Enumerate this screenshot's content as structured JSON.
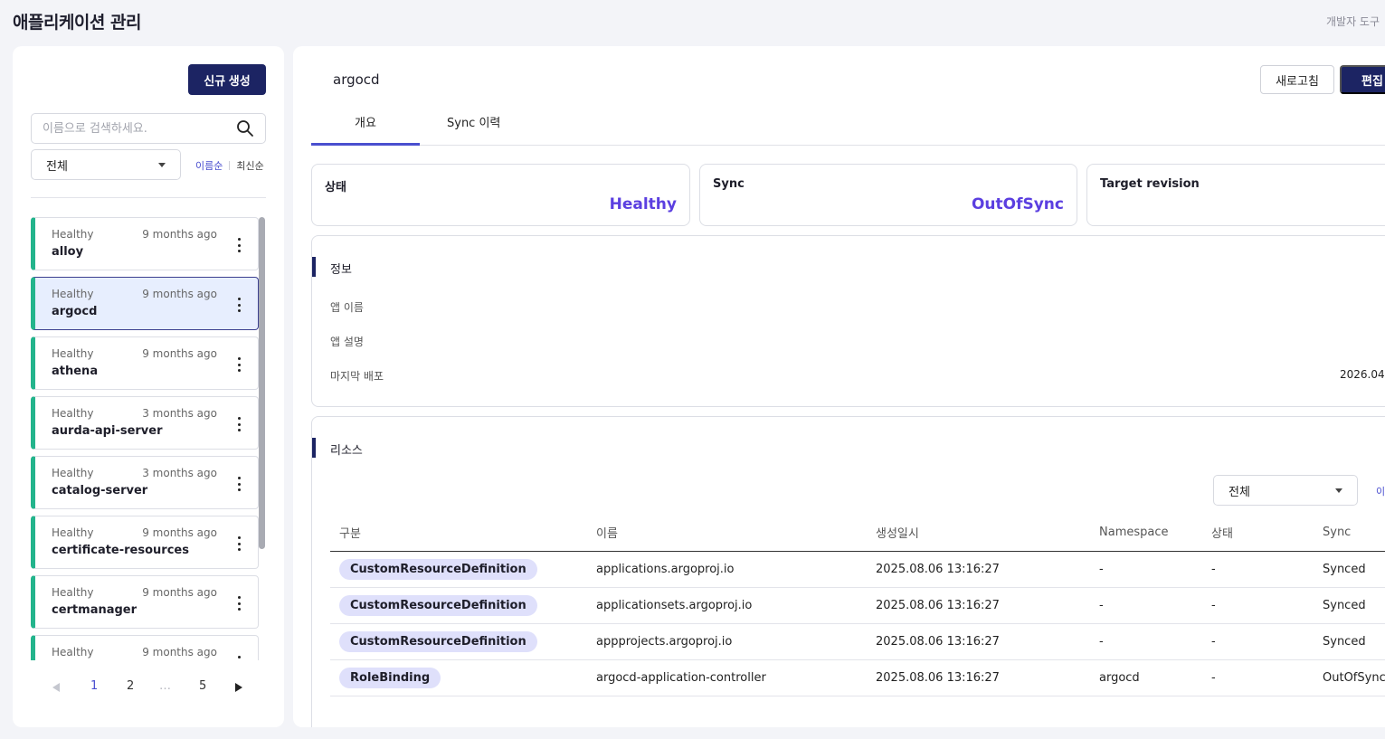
{
  "header": {
    "title": "애플리케이션 관리",
    "dev_tools": "개발자 도구"
  },
  "sidebar": {
    "new_button": "신규 생성",
    "search_placeholder": "이름으로 검색하세요.",
    "filter_value": "전체",
    "sort_name": "이름순",
    "sort_latest": "최신순",
    "items": [
      {
        "status": "Healthy",
        "time": "9 months ago",
        "name": "alloy"
      },
      {
        "status": "Healthy",
        "time": "9 months ago",
        "name": "argocd"
      },
      {
        "status": "Healthy",
        "time": "9 months ago",
        "name": "athena"
      },
      {
        "status": "Healthy",
        "time": "3 months ago",
        "name": "aurda-api-server"
      },
      {
        "status": "Healthy",
        "time": "3 months ago",
        "name": "catalog-server"
      },
      {
        "status": "Healthy",
        "time": "9 months ago",
        "name": "certificate-resources"
      },
      {
        "status": "Healthy",
        "time": "9 months ago",
        "name": "certmanager"
      },
      {
        "status": "Healthy",
        "time": "9 months ago",
        "name": ""
      }
    ],
    "selected_index": 1,
    "pagination": {
      "p1": "1",
      "p2": "2",
      "dots": "…",
      "p5": "5",
      "current": 1
    }
  },
  "detail": {
    "app_name": "argocd",
    "refresh_button": "새로고침",
    "edit_button": "편집",
    "tabs": [
      {
        "label": "개요"
      },
      {
        "label": "Sync 이력"
      }
    ],
    "active_tab": 0,
    "cards": {
      "status_label": "상태",
      "status_value": "Healthy",
      "sync_label": "Sync",
      "sync_value": "OutOfSync",
      "target_label": "Target revision"
    },
    "info": {
      "title": "정보",
      "app_name_label": "앱 이름",
      "app_desc_label": "앱 설명",
      "last_deploy_label": "마지막 배포",
      "last_deploy_value": "2026.04"
    },
    "resources": {
      "title": "리소스",
      "filter_value": "전체",
      "sort_label": "이",
      "columns": [
        "구분",
        "이름",
        "생성일시",
        "Namespace",
        "상태",
        "Sync"
      ],
      "rows": [
        {
          "kind": "CustomResourceDefinition",
          "name": "applications.argoproj.io",
          "created": "2025.08.06 13:16:27",
          "namespace": "-",
          "status": "-",
          "sync": "Synced"
        },
        {
          "kind": "CustomResourceDefinition",
          "name": "applicationsets.argoproj.io",
          "created": "2025.08.06 13:16:27",
          "namespace": "-",
          "status": "-",
          "sync": "Synced"
        },
        {
          "kind": "CustomResourceDefinition",
          "name": "appprojects.argoproj.io",
          "created": "2025.08.06 13:16:27",
          "namespace": "-",
          "status": "-",
          "sync": "Synced"
        },
        {
          "kind": "RoleBinding",
          "name": "argocd-application-controller",
          "created": "2025.08.06 13:16:27",
          "namespace": "argocd",
          "status": "-",
          "sync": "OutOfSync"
        }
      ]
    }
  },
  "colors": {
    "primary": "#1c2463",
    "accent": "#5b3fe0",
    "healthy_bar": "#23b48c",
    "chip_bg": "#dfe0fb"
  }
}
